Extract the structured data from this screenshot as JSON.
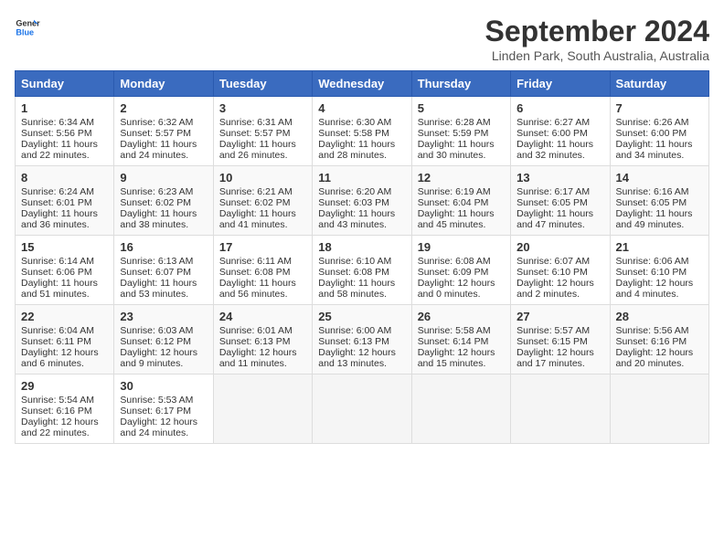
{
  "header": {
    "logo_line1": "General",
    "logo_line2": "Blue",
    "title": "September 2024",
    "subtitle": "Linden Park, South Australia, Australia"
  },
  "calendar": {
    "days_of_week": [
      "Sunday",
      "Monday",
      "Tuesday",
      "Wednesday",
      "Thursday",
      "Friday",
      "Saturday"
    ],
    "weeks": [
      [
        null,
        {
          "day": 2,
          "sunrise": "Sunrise: 6:32 AM",
          "sunset": "Sunset: 5:57 PM",
          "daylight": "Daylight: 11 hours and 24 minutes."
        },
        {
          "day": 3,
          "sunrise": "Sunrise: 6:31 AM",
          "sunset": "Sunset: 5:57 PM",
          "daylight": "Daylight: 11 hours and 26 minutes."
        },
        {
          "day": 4,
          "sunrise": "Sunrise: 6:30 AM",
          "sunset": "Sunset: 5:58 PM",
          "daylight": "Daylight: 11 hours and 28 minutes."
        },
        {
          "day": 5,
          "sunrise": "Sunrise: 6:28 AM",
          "sunset": "Sunset: 5:59 PM",
          "daylight": "Daylight: 11 hours and 30 minutes."
        },
        {
          "day": 6,
          "sunrise": "Sunrise: 6:27 AM",
          "sunset": "Sunset: 6:00 PM",
          "daylight": "Daylight: 11 hours and 32 minutes."
        },
        {
          "day": 7,
          "sunrise": "Sunrise: 6:26 AM",
          "sunset": "Sunset: 6:00 PM",
          "daylight": "Daylight: 11 hours and 34 minutes."
        }
      ],
      [
        {
          "day": 8,
          "sunrise": "Sunrise: 6:24 AM",
          "sunset": "Sunset: 6:01 PM",
          "daylight": "Daylight: 11 hours and 36 minutes."
        },
        {
          "day": 9,
          "sunrise": "Sunrise: 6:23 AM",
          "sunset": "Sunset: 6:02 PM",
          "daylight": "Daylight: 11 hours and 38 minutes."
        },
        {
          "day": 10,
          "sunrise": "Sunrise: 6:21 AM",
          "sunset": "Sunset: 6:02 PM",
          "daylight": "Daylight: 11 hours and 41 minutes."
        },
        {
          "day": 11,
          "sunrise": "Sunrise: 6:20 AM",
          "sunset": "Sunset: 6:03 PM",
          "daylight": "Daylight: 11 hours and 43 minutes."
        },
        {
          "day": 12,
          "sunrise": "Sunrise: 6:19 AM",
          "sunset": "Sunset: 6:04 PM",
          "daylight": "Daylight: 11 hours and 45 minutes."
        },
        {
          "day": 13,
          "sunrise": "Sunrise: 6:17 AM",
          "sunset": "Sunset: 6:05 PM",
          "daylight": "Daylight: 11 hours and 47 minutes."
        },
        {
          "day": 14,
          "sunrise": "Sunrise: 6:16 AM",
          "sunset": "Sunset: 6:05 PM",
          "daylight": "Daylight: 11 hours and 49 minutes."
        }
      ],
      [
        {
          "day": 15,
          "sunrise": "Sunrise: 6:14 AM",
          "sunset": "Sunset: 6:06 PM",
          "daylight": "Daylight: 11 hours and 51 minutes."
        },
        {
          "day": 16,
          "sunrise": "Sunrise: 6:13 AM",
          "sunset": "Sunset: 6:07 PM",
          "daylight": "Daylight: 11 hours and 53 minutes."
        },
        {
          "day": 17,
          "sunrise": "Sunrise: 6:11 AM",
          "sunset": "Sunset: 6:08 PM",
          "daylight": "Daylight: 11 hours and 56 minutes."
        },
        {
          "day": 18,
          "sunrise": "Sunrise: 6:10 AM",
          "sunset": "Sunset: 6:08 PM",
          "daylight": "Daylight: 11 hours and 58 minutes."
        },
        {
          "day": 19,
          "sunrise": "Sunrise: 6:08 AM",
          "sunset": "Sunset: 6:09 PM",
          "daylight": "Daylight: 12 hours and 0 minutes."
        },
        {
          "day": 20,
          "sunrise": "Sunrise: 6:07 AM",
          "sunset": "Sunset: 6:10 PM",
          "daylight": "Daylight: 12 hours and 2 minutes."
        },
        {
          "day": 21,
          "sunrise": "Sunrise: 6:06 AM",
          "sunset": "Sunset: 6:10 PM",
          "daylight": "Daylight: 12 hours and 4 minutes."
        }
      ],
      [
        {
          "day": 22,
          "sunrise": "Sunrise: 6:04 AM",
          "sunset": "Sunset: 6:11 PM",
          "daylight": "Daylight: 12 hours and 6 minutes."
        },
        {
          "day": 23,
          "sunrise": "Sunrise: 6:03 AM",
          "sunset": "Sunset: 6:12 PM",
          "daylight": "Daylight: 12 hours and 9 minutes."
        },
        {
          "day": 24,
          "sunrise": "Sunrise: 6:01 AM",
          "sunset": "Sunset: 6:13 PM",
          "daylight": "Daylight: 12 hours and 11 minutes."
        },
        {
          "day": 25,
          "sunrise": "Sunrise: 6:00 AM",
          "sunset": "Sunset: 6:13 PM",
          "daylight": "Daylight: 12 hours and 13 minutes."
        },
        {
          "day": 26,
          "sunrise": "Sunrise: 5:58 AM",
          "sunset": "Sunset: 6:14 PM",
          "daylight": "Daylight: 12 hours and 15 minutes."
        },
        {
          "day": 27,
          "sunrise": "Sunrise: 5:57 AM",
          "sunset": "Sunset: 6:15 PM",
          "daylight": "Daylight: 12 hours and 17 minutes."
        },
        {
          "day": 28,
          "sunrise": "Sunrise: 5:56 AM",
          "sunset": "Sunset: 6:16 PM",
          "daylight": "Daylight: 12 hours and 20 minutes."
        }
      ],
      [
        {
          "day": 29,
          "sunrise": "Sunrise: 5:54 AM",
          "sunset": "Sunset: 6:16 PM",
          "daylight": "Daylight: 12 hours and 22 minutes."
        },
        {
          "day": 30,
          "sunrise": "Sunrise: 5:53 AM",
          "sunset": "Sunset: 6:17 PM",
          "daylight": "Daylight: 12 hours and 24 minutes."
        },
        null,
        null,
        null,
        null,
        null
      ]
    ],
    "week0_sunday": {
      "day": 1,
      "sunrise": "Sunrise: 6:34 AM",
      "sunset": "Sunset: 5:56 PM",
      "daylight": "Daylight: 11 hours and 22 minutes."
    }
  }
}
